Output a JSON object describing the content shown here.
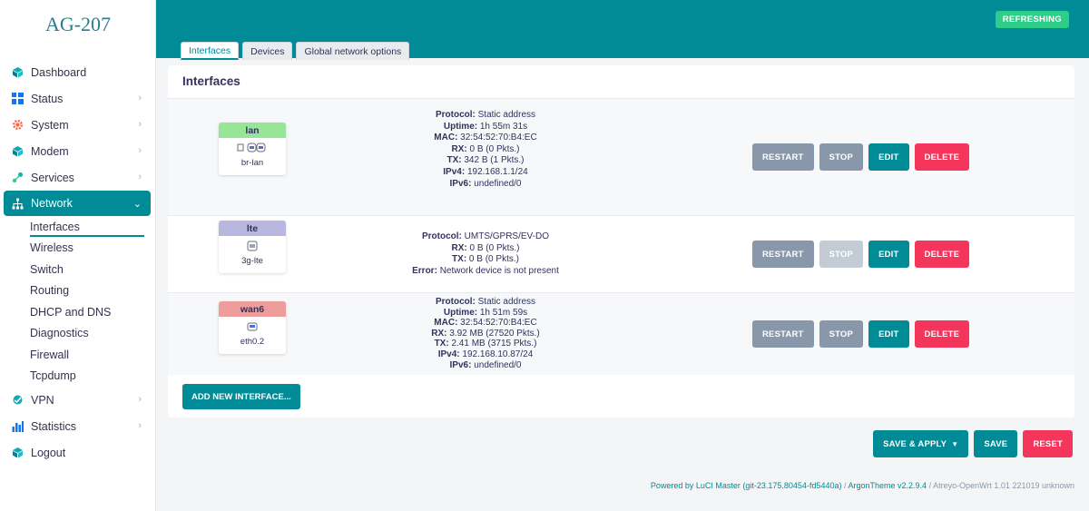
{
  "brand": "AG-207",
  "status_badge": "REFRESHING",
  "sidebar": {
    "items": [
      {
        "label": "Dashboard",
        "icon": "cube-icon"
      },
      {
        "label": "Status",
        "icon": "grid-icon"
      },
      {
        "label": "System",
        "icon": "gear-icon"
      },
      {
        "label": "Modem",
        "icon": "cube-icon"
      },
      {
        "label": "Services",
        "icon": "services-icon"
      },
      {
        "label": "Network",
        "icon": "network-icon"
      },
      {
        "label": "VPN",
        "icon": "vpn-icon"
      },
      {
        "label": "Statistics",
        "icon": "bar-chart-icon"
      },
      {
        "label": "Logout",
        "icon": "cube-icon"
      }
    ],
    "network_sub": [
      "Interfaces",
      "Wireless",
      "Switch",
      "Routing",
      "DHCP and DNS",
      "Diagnostics",
      "Firewall",
      "Tcpdump"
    ]
  },
  "tabs": [
    "Interfaces",
    "Devices",
    "Global network options"
  ],
  "card_title": "Interfaces",
  "interfaces": [
    {
      "name": "lan",
      "device": "br-lan",
      "head_color": "#98e598",
      "lines": [
        {
          "k": "Protocol:",
          "v": " Static address"
        },
        {
          "k": "Uptime:",
          "v": " 1h 55m 31s"
        },
        {
          "k": "MAC:",
          "v": " 32:54:52:70:B4:EC"
        },
        {
          "k": "RX:",
          "v": " 0 B (0 Pkts.)"
        },
        {
          "k": "TX:",
          "v": " 342 B (1 Pkts.)"
        },
        {
          "k": "IPv4:",
          "v": " 192.168.1.1/24"
        },
        {
          "k": "IPv6:",
          "v": " undefined/0"
        }
      ]
    },
    {
      "name": "lte",
      "device": "3g-lte",
      "head_color": "#b7b7e0",
      "lines": [
        {
          "k": "Protocol:",
          "v": " UMTS/GPRS/EV-DO"
        },
        {
          "k": "RX:",
          "v": " 0 B (0 Pkts.)"
        },
        {
          "k": "TX:",
          "v": " 0 B (0 Pkts.)"
        },
        {
          "k": "Error:",
          "v": " Network device is not present"
        }
      ]
    },
    {
      "name": "wan6",
      "device": "eth0.2",
      "head_color": "#ef9c9c",
      "lines": [
        {
          "k": "Protocol:",
          "v": " Static address"
        },
        {
          "k": "Uptime:",
          "v": " 1h 51m 59s"
        },
        {
          "k": "MAC:",
          "v": " 32:54:52:70:B4:EC"
        },
        {
          "k": "RX:",
          "v": " 3.92 MB (27520 Pkts.)"
        },
        {
          "k": "TX:",
          "v": " 2.41 MB (3715 Pkts.)"
        },
        {
          "k": "IPv4:",
          "v": " 192.168.10.87/24"
        },
        {
          "k": "IPv6:",
          "v": " undefined/0"
        }
      ]
    }
  ],
  "row_actions": {
    "restart": "RESTART",
    "stop": "STOP",
    "edit": "EDIT",
    "delete": "DELETE"
  },
  "add_interface": "ADD NEW INTERFACE...",
  "bottom": {
    "save_apply": "SAVE & APPLY",
    "save": "SAVE",
    "reset": "RESET"
  },
  "footer": {
    "powered": "Powered by LuCI Master (git-23.175.80454-fd5440a)",
    "sep": " / ",
    "theme": "ArgonTheme v2.2.9.4",
    "rest": " / Atreyo-OpenWrt 1.01 221019 unknown"
  }
}
